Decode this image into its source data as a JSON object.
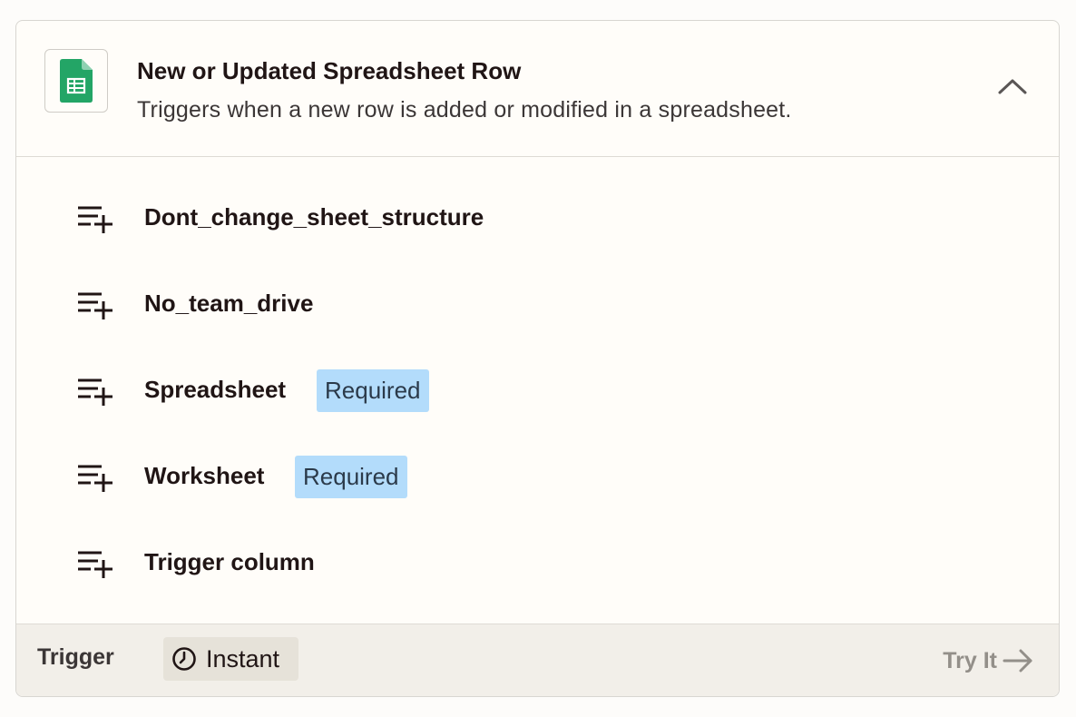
{
  "trigger_card": {
    "title": "New or Updated Spreadsheet Row",
    "description": "Triggers when a new row is added or modified in a spreadsheet.",
    "app_icon": "google-sheets-icon",
    "collapse_icon": "chevron-up-icon"
  },
  "fields": [
    {
      "label": "Dont_change_sheet_structure",
      "badge": "",
      "icon": "add-field-icon"
    },
    {
      "label": "No_team_drive",
      "badge": "",
      "icon": "add-field-icon"
    },
    {
      "label": "Spreadsheet",
      "badge": "Required",
      "icon": "add-field-icon"
    },
    {
      "label": "Worksheet",
      "badge": "Required",
      "icon": "add-field-icon"
    },
    {
      "label": "Trigger column",
      "badge": "",
      "icon": "add-field-icon"
    }
  ],
  "footer": {
    "label": "Trigger",
    "mode_label": "Instant",
    "mode_icon": "clock-icon",
    "action_label": "Try It",
    "action_icon": "arrow-right-icon"
  },
  "colors": {
    "required_badge": "#b3dcfb",
    "sheets_green": "#23a566",
    "footer_bg": "#f2efe9"
  }
}
